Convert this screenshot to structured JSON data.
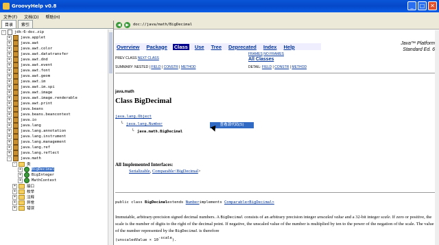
{
  "window": {
    "title": "GroovyHelp v0.8"
  },
  "menu": [
    "文件(F)",
    "文档(D)",
    "帮助(H)"
  ],
  "tabs": [
    "目录",
    "索引"
  ],
  "tree": [
    {
      "label": "jdk-6-doc.zip",
      "type": "doc",
      "level": 0,
      "toggle": "-"
    },
    {
      "label": "java.applet",
      "type": "pkg",
      "level": 1,
      "toggle": "+"
    },
    {
      "label": "java.awt",
      "type": "pkg",
      "level": 1,
      "toggle": "+"
    },
    {
      "label": "java.awt.color",
      "type": "pkg",
      "level": 1,
      "toggle": "+"
    },
    {
      "label": "java.awt.datatransfer",
      "type": "pkg",
      "level": 1,
      "toggle": "+"
    },
    {
      "label": "java.awt.dnd",
      "type": "pkg",
      "level": 1,
      "toggle": "+"
    },
    {
      "label": "java.awt.event",
      "type": "pkg",
      "level": 1,
      "toggle": "+"
    },
    {
      "label": "java.awt.font",
      "type": "pkg",
      "level": 1,
      "toggle": "+"
    },
    {
      "label": "java.awt.geom",
      "type": "pkg",
      "level": 1,
      "toggle": "+"
    },
    {
      "label": "java.awt.im",
      "type": "pkg",
      "level": 1,
      "toggle": "+"
    },
    {
      "label": "java.awt.im.spi",
      "type": "pkg",
      "level": 1,
      "toggle": "+"
    },
    {
      "label": "java.awt.image",
      "type": "pkg",
      "level": 1,
      "toggle": "+"
    },
    {
      "label": "java.awt.image.renderable",
      "type": "pkg",
      "level": 1,
      "toggle": "+"
    },
    {
      "label": "java.awt.print",
      "type": "pkg",
      "level": 1,
      "toggle": "+"
    },
    {
      "label": "java.beans",
      "type": "pkg",
      "level": 1,
      "toggle": "+"
    },
    {
      "label": "java.beans.beancontext",
      "type": "pkg",
      "level": 1,
      "toggle": "+"
    },
    {
      "label": "java.io",
      "type": "pkg",
      "level": 1,
      "toggle": "+"
    },
    {
      "label": "java.lang",
      "type": "pkg",
      "level": 1,
      "toggle": "+"
    },
    {
      "label": "java.lang.annotation",
      "type": "pkg",
      "level": 1,
      "toggle": "+"
    },
    {
      "label": "java.lang.instrument",
      "type": "pkg",
      "level": 1,
      "toggle": "+"
    },
    {
      "label": "java.lang.management",
      "type": "pkg",
      "level": 1,
      "toggle": "+"
    },
    {
      "label": "java.lang.ref",
      "type": "pkg",
      "level": 1,
      "toggle": "+"
    },
    {
      "label": "java.lang.reflect",
      "type": "pkg",
      "level": 1,
      "toggle": "+"
    },
    {
      "label": "java.math",
      "type": "pkg",
      "level": 1,
      "toggle": "-"
    },
    {
      "label": "类",
      "type": "folder",
      "level": 2,
      "toggle": "-"
    },
    {
      "label": "BigDecimal",
      "type": "class",
      "level": 3,
      "toggle": "+",
      "selected": true
    },
    {
      "label": "BigInteger",
      "type": "class",
      "level": 3,
      "toggle": "+"
    },
    {
      "label": "MathContext",
      "type": "class",
      "level": 3,
      "toggle": "+"
    },
    {
      "label": "接口",
      "type": "folder",
      "level": 2,
      "toggle": "+"
    },
    {
      "label": "枚举",
      "type": "folder",
      "level": 2,
      "toggle": "+"
    },
    {
      "label": "注释",
      "type": "folder",
      "level": 2,
      "toggle": "+"
    },
    {
      "label": "异常",
      "type": "folder",
      "level": 2,
      "toggle": "+"
    },
    {
      "label": "错误",
      "type": "folder",
      "level": 2,
      "toggle": "+"
    }
  ],
  "address": "doc://java/math/BigDecimal",
  "nav": {
    "items": [
      {
        "label": "Overview",
        "link": true
      },
      {
        "label": "Package",
        "link": true
      },
      {
        "label": "Class",
        "link": false
      },
      {
        "label": "Use",
        "link": true
      },
      {
        "label": "Tree",
        "link": true
      },
      {
        "label": "Deprecated",
        "link": true
      },
      {
        "label": "Index",
        "link": true
      },
      {
        "label": "Help",
        "link": true
      }
    ],
    "platform1": "Java™ Platform",
    "platform2": "Standard Ed. 6",
    "prev_class": "PREV CLASS",
    "next_class": "NEXT CLASS",
    "frames": "FRAMES",
    "no_frames": "NO FRAMES",
    "all_classes": "All Classes",
    "summary_prefix": "SUMMARY: NESTED |",
    "field": "FIELD",
    "constr": "CONSTR",
    "method": "METHOD",
    "detail_prefix": "DETAIL:",
    "sep": "|"
  },
  "content": {
    "package": "java.math",
    "class_title": "Class BigDecimal",
    "h1": "java.lang.Object",
    "h2": "java.lang.Number",
    "h3": "java.math.BigDecimal",
    "tooltip": "查看源代码(S)",
    "impl_heading": "All Implemented Interfaces:",
    "impl_1": "Serializable",
    "impl_sep": ", ",
    "impl_2a": "Comparable<",
    "impl_2b": "BigDecimal",
    "impl_2c": ">",
    "decl_1": "public class ",
    "decl_2": "BigDecimal",
    "decl_3": "extends ",
    "decl_4": "Number",
    "decl_5": "implements ",
    "decl_6": "Comparable<BigDecimal>",
    "desc_1": "Immutable, arbitrary-precision signed decimal numbers. A ",
    "desc_code1": "BigDecimal",
    "desc_2": " consists of an arbitrary precision integer ",
    "desc_em1": "unscaled value",
    "desc_3": " and a 32-bit integer ",
    "desc_em2": "scale",
    "desc_4": ". If zero or positive, the scale is the number of digits to the right of the decimal point. If negative, the unscaled value of the number is multiplied by ten to the power of the negation of the scale. The value of the number represented by the ",
    "desc_code2": "BigDecimal",
    "desc_5": " is therefore",
    "formula_1": "(unscaledValue × 10",
    "formula_sup": "-scale",
    "formula_2": ")."
  }
}
